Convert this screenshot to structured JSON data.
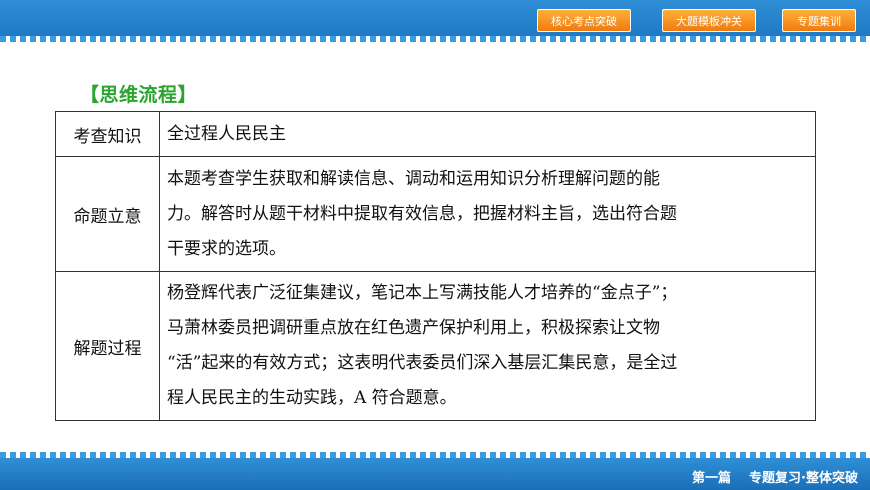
{
  "nav": {
    "btn1": "核心考点突破",
    "btn2": "大题模板冲关",
    "btn3": "专题集训"
  },
  "heading": "【思维流程】",
  "table": {
    "rows": [
      {
        "label": "考查知识",
        "lines": [
          "全过程人民民主"
        ]
      },
      {
        "label": "命题立意",
        "lines": [
          "本题考查学生获取和解读信息、调动和运用知识分析理解问题的能",
          "力。解答时从题干材料中提取有效信息，把握材料主旨，选出符合题",
          "干要求的选项。"
        ]
      },
      {
        "label": "解题过程",
        "lines": [
          "杨登辉代表广泛征集建议，笔记本上写满技能人才培养的“金点子”；",
          "马萧林委员把调研重点放在红色遗产保护利用上，积极探索让文物",
          "“活”起来的有效方式；这表明代表委员们深入基层汇集民意，是全过",
          "程人民民主的生动实践，A 符合题意。"
        ]
      }
    ]
  },
  "footer": {
    "part": "第一篇",
    "title": "专题复习·整体突破"
  }
}
